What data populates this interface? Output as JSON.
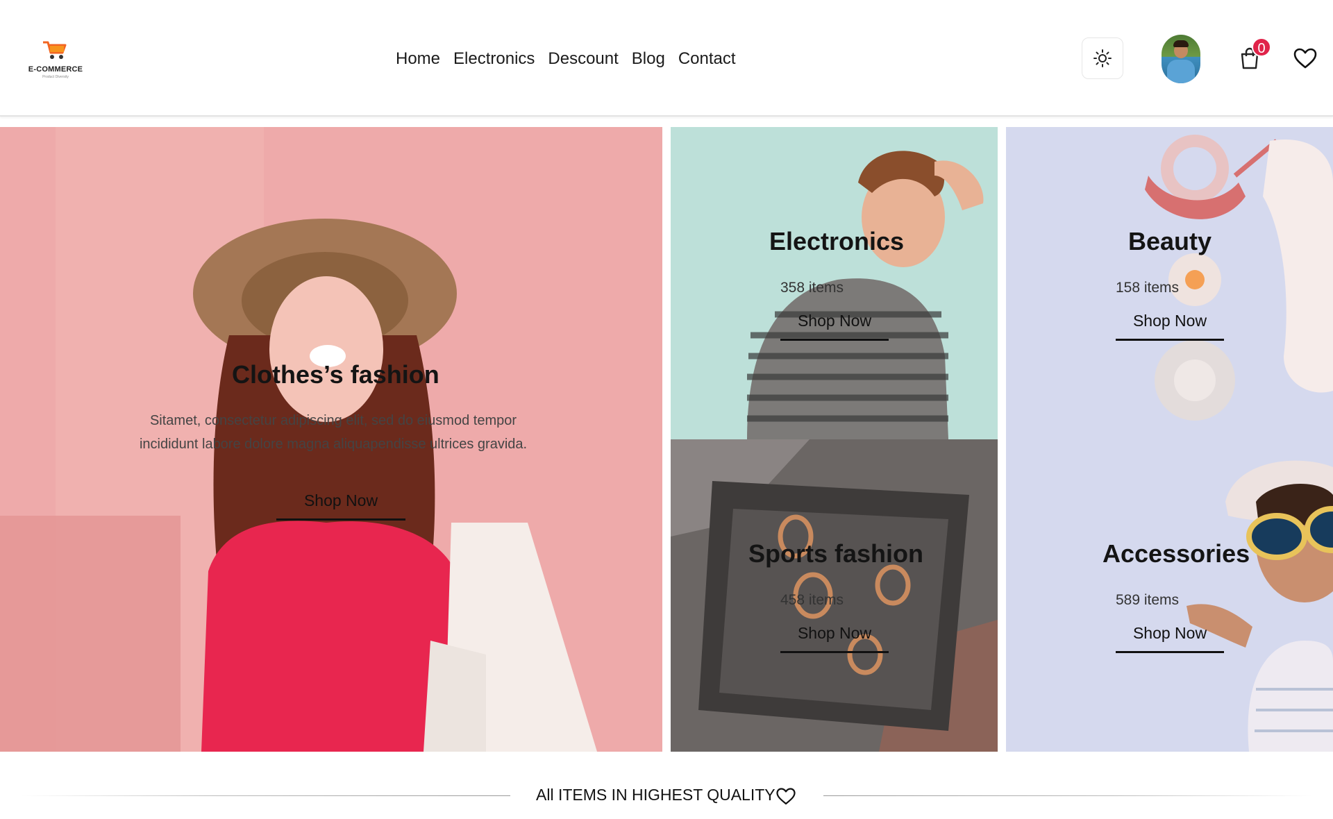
{
  "logo": {
    "text": "E-COMMERCE",
    "subtext": "Product Diversity"
  },
  "nav": [
    "Home",
    "Electronics",
    "Descount",
    "Blog",
    "Contact"
  ],
  "header": {
    "cart_count": "0"
  },
  "colors": {
    "accent": "#e0244a",
    "clothes_bg": "#eeaaaa",
    "electronics_bg": "#bde0d9",
    "beauty_bg": "#d5d9ee",
    "logo_orange": "#f26522"
  },
  "hero": {
    "clothes": {
      "title": "Clothes’s fashion",
      "desc": "Sitamet, consectetur adipiscing elit, sed do eiusmod tempor incididunt labore dolore magna aliquapendisse ultrices gravida.",
      "cta": "Shop Now"
    },
    "electronics": {
      "title": "Electronics",
      "count": "358 items",
      "cta": "Shop Now"
    },
    "sports": {
      "title": "Sports fashion",
      "count": "458 items",
      "cta": "Shop Now"
    },
    "beauty": {
      "title": "Beauty",
      "count": "158 items",
      "cta": "Shop Now"
    },
    "accessories": {
      "title": "Accessories",
      "count": "589 items",
      "cta": "Shop Now"
    }
  },
  "quality": {
    "text": "All ITEMS IN HIGHEST QUALITY"
  },
  "icons": {
    "theme": "sun-icon",
    "cart": "shopping-bag-icon",
    "wishlist": "heart-icon"
  }
}
